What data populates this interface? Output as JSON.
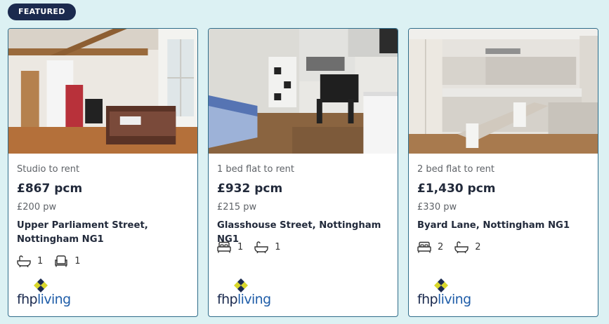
{
  "badge": "FEATURED",
  "listings": [
    {
      "type": "Studio to rent",
      "price": "£867 pcm",
      "weekly": "£200 pw",
      "address": "Upper Parliament Street, Nottingham NG1",
      "features": [
        {
          "icon": "bath-icon",
          "value": "1"
        },
        {
          "icon": "sofa-icon",
          "value": "1"
        }
      ],
      "logo": {
        "part1": "fhp",
        "part2": "living"
      }
    },
    {
      "type": "1 bed flat to rent",
      "price": "£932 pcm",
      "weekly": "£215 pw",
      "address": "Glasshouse Street, Nottingham NG1",
      "features": [
        {
          "icon": "bed-icon",
          "value": "1"
        },
        {
          "icon": "bath-icon",
          "value": "1"
        }
      ],
      "logo": {
        "part1": "fhp",
        "part2": "living"
      }
    },
    {
      "type": "2 bed flat to rent",
      "price": "£1,430 pcm",
      "weekly": "£330 pw",
      "address": "Byard Lane, Nottingham NG1",
      "features": [
        {
          "icon": "bed-icon",
          "value": "2"
        },
        {
          "icon": "bath-icon",
          "value": "2"
        }
      ],
      "logo": {
        "part1": "fhp",
        "part2": "living"
      }
    }
  ],
  "colors": {
    "background": "#dcf1f3",
    "badge": "#1b2a4e",
    "card_border": "#2f6d8a",
    "logo_yellow": "#d8d62a",
    "logo_navy": "#1b2a4e"
  }
}
